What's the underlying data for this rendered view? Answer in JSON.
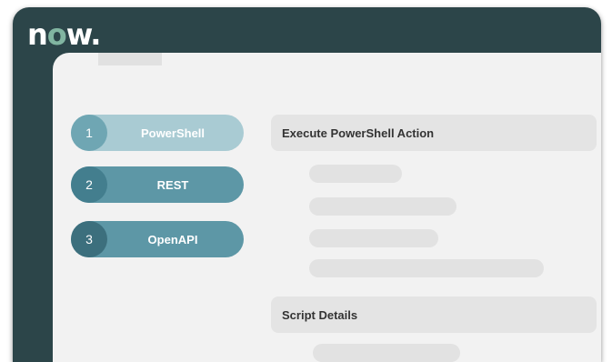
{
  "brand": {
    "logo_n": "n",
    "logo_o": "o",
    "logo_w": "w",
    "logo_dot": ".",
    "accent": "#81b5a1",
    "frame_color": "#2c4549"
  },
  "steps": [
    {
      "number": "1",
      "label": "PowerShell"
    },
    {
      "number": "2",
      "label": "REST"
    },
    {
      "number": "3",
      "label": "OpenAPI"
    }
  ],
  "main": {
    "section1_title": "Execute PowerShell Action",
    "section2_title": "Script Details"
  }
}
